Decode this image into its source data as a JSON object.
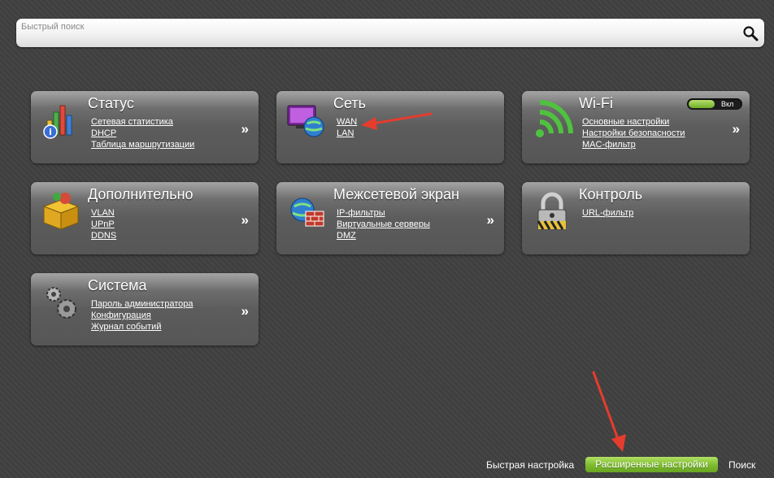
{
  "search": {
    "placeholder": "Быстрый поиск"
  },
  "tiles": [
    {
      "title": "Статус",
      "links": [
        "Сетевая статистика",
        "DHCP",
        "Таблица маршрутизации"
      ],
      "arrow": "»"
    },
    {
      "title": "Сеть",
      "links": [
        "WAN",
        "LAN"
      ]
    },
    {
      "title": "Wi-Fi",
      "links": [
        "Основные настройки",
        "Настройки безопасности",
        "MAC-фильтр"
      ],
      "arrow": "»",
      "toggle": {
        "label": "Вкл",
        "state": "on"
      }
    },
    {
      "title": "Дополнительно",
      "links": [
        "VLAN",
        "UPnP",
        "DDNS"
      ],
      "arrow": "»"
    },
    {
      "title": "Межсетевой экран",
      "links": [
        "IP-фильтры",
        "Виртуальные серверы",
        "DMZ"
      ],
      "arrow": "»"
    },
    {
      "title": "Контроль",
      "links": [
        "URL-фильтр"
      ]
    },
    {
      "title": "Система",
      "links": [
        "Пароль администратора",
        "Конфигурация",
        "Журнал событий"
      ],
      "arrow": "»"
    }
  ],
  "footer": {
    "quick_setup": "Быстрая настройка",
    "advanced": "Расширенные настройки",
    "search": "Поиск"
  },
  "colors": {
    "background": "#3f3f3f",
    "accent_green": "#7cbb2e",
    "annotation_red": "#e53c2e"
  }
}
